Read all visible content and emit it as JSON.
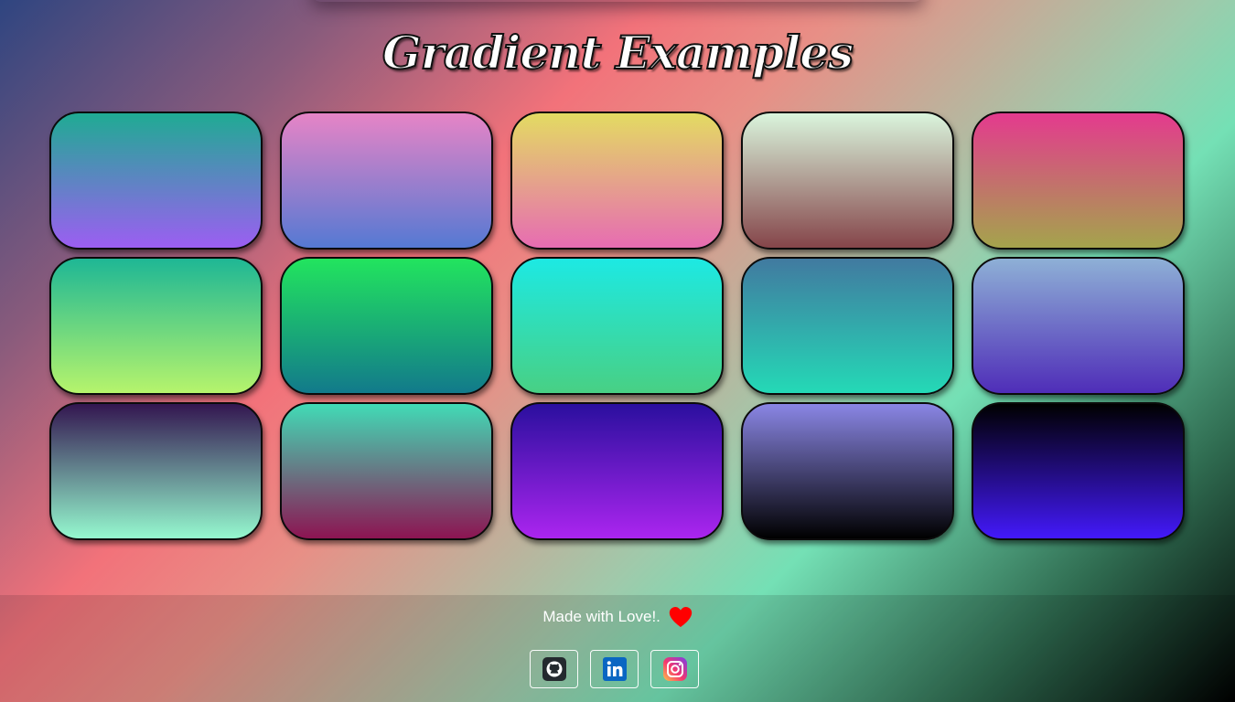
{
  "page": {
    "title": "Gradient Examples"
  },
  "gradients": [
    {
      "top": "#1fab93",
      "bottom": "#9c5ef2"
    },
    {
      "top": "#e684c6",
      "bottom": "#5579d3"
    },
    {
      "top": "#e3db62",
      "bottom": "#e76cb2"
    },
    {
      "top": "#daf5dd",
      "bottom": "#85454a"
    },
    {
      "top": "#e43a8e",
      "bottom": "#a4a44c"
    },
    {
      "top": "#1eb795",
      "bottom": "#b6f46c"
    },
    {
      "top": "#22e45e",
      "bottom": "#127a8b"
    },
    {
      "top": "#1de9e3",
      "bottom": "#48d084"
    },
    {
      "top": "#417aa0",
      "bottom": "#24d9b6"
    },
    {
      "top": "#8eb0d6",
      "bottom": "#4f2db8"
    },
    {
      "top": "#331650",
      "bottom": "#95f9cf"
    },
    {
      "top": "#41dbb6",
      "bottom": "#8d1452"
    },
    {
      "top": "#2a0f9e",
      "bottom": "#ab25ef"
    },
    {
      "top": "#8a86e5",
      "bottom": "#000000"
    },
    {
      "top": "#000000",
      "bottom": "#4319fa"
    }
  ],
  "footer": {
    "made_with": "Made with Love!.",
    "heart_color": "#ff0000",
    "socials": [
      {
        "icon": "github-icon",
        "label": "GitHub"
      },
      {
        "icon": "linkedin-icon",
        "label": "LinkedIn"
      },
      {
        "icon": "instagram-icon",
        "label": "Instagram"
      }
    ]
  }
}
